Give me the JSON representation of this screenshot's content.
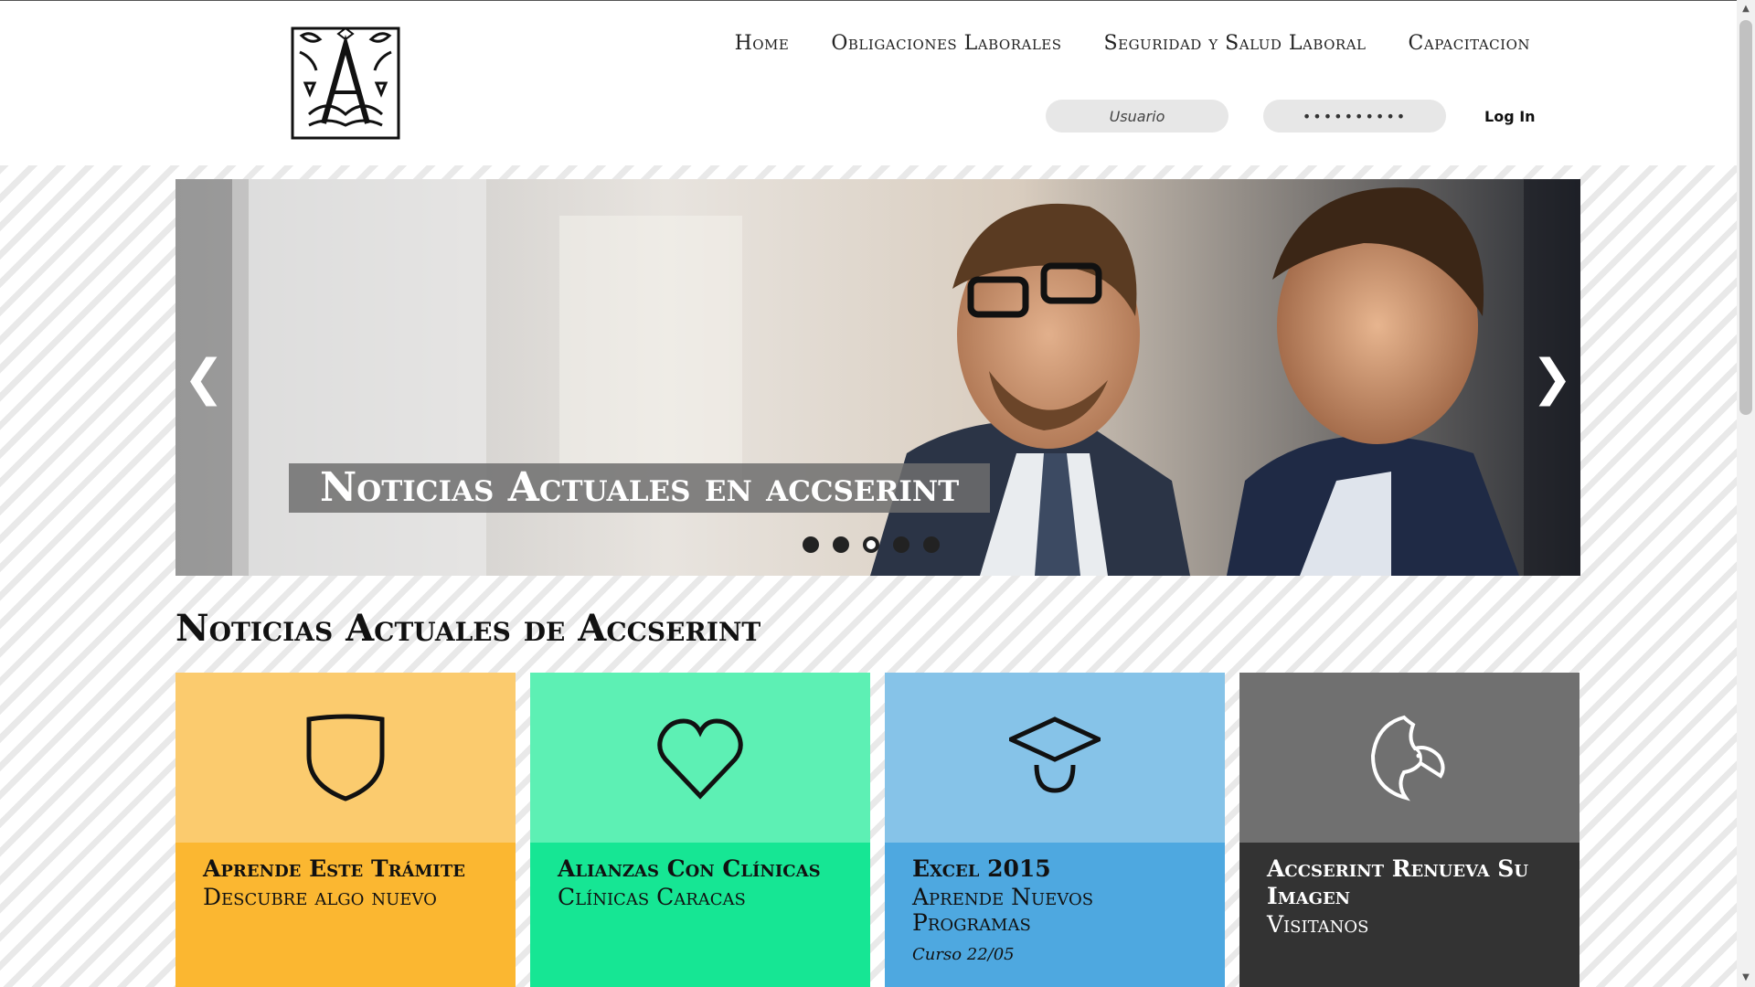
{
  "nav": {
    "items": [
      "Home",
      "Obligaciones Laborales",
      "Seguridad y Salud Laboral",
      "Capacitacion"
    ]
  },
  "login": {
    "user_placeholder": "Usuario",
    "password_value": "••••••••••",
    "button_label": "Log In"
  },
  "slider": {
    "caption": "Noticias Actuales en accserint",
    "dot_count": 5,
    "active_dot": 3
  },
  "news": {
    "heading": "Noticias Actuales de Accserint",
    "cards": [
      {
        "icon": "shield-icon",
        "title": "Aprende Este Trámite",
        "subtitle": "Descubre algo nuevo",
        "meta": "",
        "top_color": "#fbcb6e",
        "bottom_color": "#fbb731"
      },
      {
        "icon": "heart-icon",
        "title": "Alianzas Con Clínicas",
        "subtitle": "Clínicas Caracas",
        "meta": "",
        "top_color": "#5df0b4",
        "bottom_color": "#16e694"
      },
      {
        "icon": "graduation-cap-icon",
        "title": "Excel 2015",
        "subtitle": "Aprende Nuevos Programas",
        "meta": "Curso 22/05",
        "top_color": "#86c3e8",
        "bottom_color": "#4ea8e0"
      },
      {
        "icon": "bird-logo-icon",
        "title": "Accserint Renueva Su Imagen",
        "subtitle": "Visitanos",
        "meta": "",
        "top_color": "#707070",
        "bottom_color": "#333333"
      }
    ]
  }
}
